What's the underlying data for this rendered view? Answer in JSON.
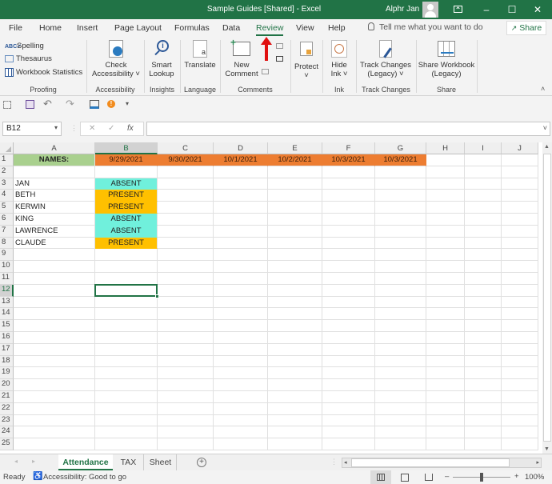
{
  "titlebar": {
    "title": "Sample Guides  [Shared]  -  Excel",
    "user": "Alphr Jan",
    "restore_icon": "ribbon-display-icon",
    "minimize": "–",
    "maximize": "☐",
    "close": "✕"
  },
  "menu": {
    "items": [
      "File",
      "Home",
      "Insert",
      "Page Layout",
      "Formulas",
      "Data",
      "Review",
      "View",
      "Help"
    ],
    "active": "Review",
    "tell_me": "Tell me what you want to do",
    "share": "Share"
  },
  "ribbon": {
    "proofing": {
      "spelling": "Spelling",
      "thesaurus": "Thesaurus",
      "workbook_statistics": "Workbook Statistics",
      "label": "Proofing"
    },
    "accessibility": {
      "check_line1": "Check",
      "check_line2": "Accessibility ˅",
      "label": "Accessibility"
    },
    "insights": {
      "smart_line1": "Smart",
      "smart_line2": "Lookup",
      "label": "Insights"
    },
    "language": {
      "translate": "Translate",
      "label": "Language"
    },
    "comments": {
      "new_line1": "New",
      "new_line2": "Comment",
      "label": "Comments"
    },
    "protect": {
      "protect": "Protect",
      "caret": "˅"
    },
    "ink": {
      "hide_line1": "Hide",
      "hide_line2": "Ink ˅",
      "label": "Ink"
    },
    "track_changes": {
      "line1": "Track Changes",
      "line2": "(Legacy) ˅",
      "label": "Track Changes"
    },
    "share": {
      "line1": "Share Workbook",
      "line2": "(Legacy)",
      "label": "Share"
    },
    "collapse": "˄"
  },
  "formula_bar": {
    "name_box": "B12",
    "cancel": "✕",
    "enter": "✓",
    "fx": "fx",
    "value": ""
  },
  "sheet": {
    "columns": [
      "A",
      "B",
      "C",
      "D",
      "E",
      "F",
      "G",
      "H",
      "I",
      "J"
    ],
    "selected_column": "B",
    "selected_row": 12,
    "active_cell": "B12",
    "rows": [
      "1",
      "2",
      "3",
      "4",
      "5",
      "6",
      "7",
      "8",
      "9",
      "10",
      "11",
      "12",
      "13",
      "14",
      "15",
      "16",
      "17",
      "18",
      "19",
      "20",
      "21",
      "22",
      "23",
      "24",
      "25"
    ],
    "header_row": {
      "names_label": "NAMES:",
      "dates": [
        "9/29/2021",
        "9/30/2021",
        "10/1/2021",
        "10/2/2021",
        "10/3/2021",
        "10/3/2021"
      ]
    },
    "records": [
      {
        "name": "JAN",
        "status": "ABSENT"
      },
      {
        "name": "BETH",
        "status": "PRESENT"
      },
      {
        "name": "KERWIN",
        "status": "PRESENT"
      },
      {
        "name": "KING",
        "status": "ABSENT"
      },
      {
        "name": "LAWRENCE",
        "status": "ABSENT"
      },
      {
        "name": "CLAUDE",
        "status": "PRESENT"
      }
    ],
    "colors": {
      "names_header": "#a9d08e",
      "date_header": "#ed7d31",
      "absent": "#70f0dc",
      "present": "#ffc000",
      "accent": "#217346"
    }
  },
  "tabs": {
    "items": [
      "Attendance",
      "TAX",
      "Sheet"
    ],
    "active": "Attendance",
    "add": "+"
  },
  "status": {
    "ready": "Ready",
    "accessibility": "Accessibility: Good to go",
    "zoom": "100%",
    "zoom_minus": "–",
    "zoom_plus": "+"
  }
}
